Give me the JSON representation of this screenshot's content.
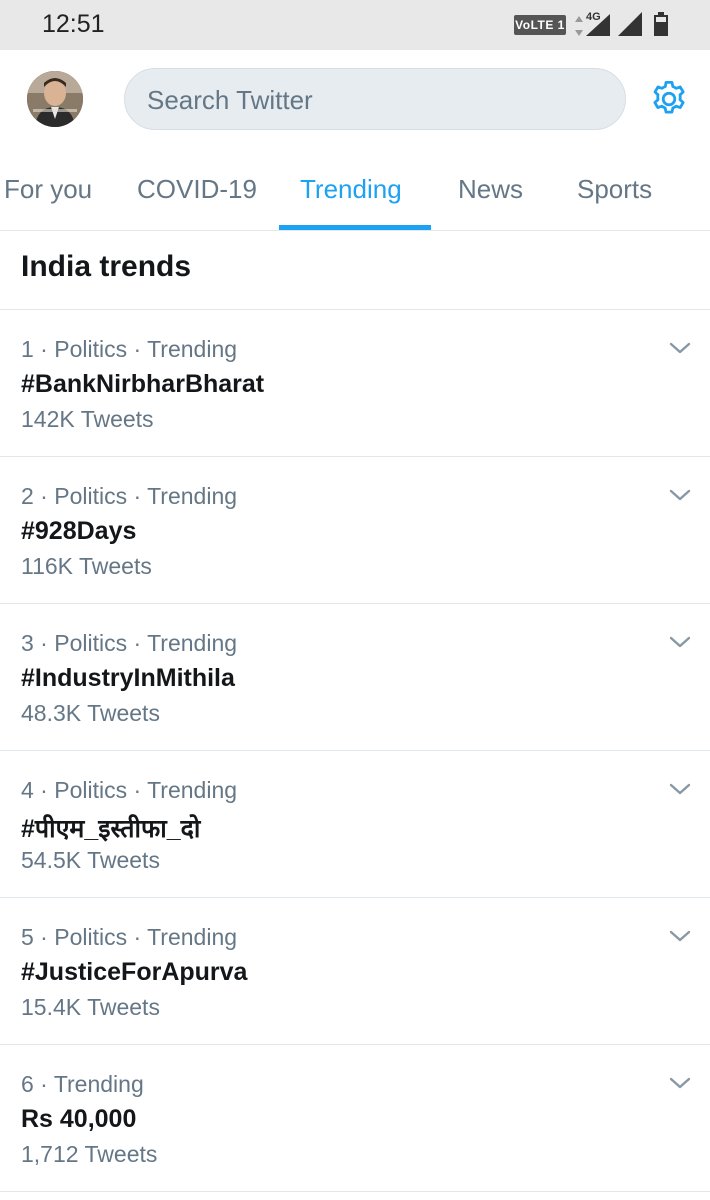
{
  "status_bar": {
    "time": "12:51",
    "volte": "VoLTE 1",
    "network": "4G"
  },
  "header": {
    "search_placeholder": "Search Twitter"
  },
  "tabs": [
    {
      "label": "For you"
    },
    {
      "label": "COVID-19"
    },
    {
      "label": "Trending",
      "active": true
    },
    {
      "label": "News"
    },
    {
      "label": "Sports"
    }
  ],
  "section": {
    "title": "India trends"
  },
  "trends": [
    {
      "meta": "1 · Politics · Trending",
      "name": "#BankNirbharBharat",
      "count": "142K Tweets"
    },
    {
      "meta": "2 · Politics · Trending",
      "name": "#928Days",
      "count": "116K Tweets"
    },
    {
      "meta": "3 · Politics · Trending",
      "name": "#IndustryInMithila",
      "count": "48.3K Tweets"
    },
    {
      "meta": "4 · Politics · Trending",
      "name": "#पीएम_इस्तीफा_दो",
      "count": "54.5K Tweets"
    },
    {
      "meta": "5 · Politics · Trending",
      "name": "#JusticeForApurva",
      "count": "15.4K Tweets"
    },
    {
      "meta": "6 · Trending",
      "name": "Rs 40,000",
      "count": "1,712 Tweets"
    }
  ],
  "colors": {
    "accent": "#1da1f2",
    "secondary_text": "#657786",
    "primary_text": "#14171a",
    "divider": "#e1e8ed"
  },
  "icons": {
    "settings": "gear-icon",
    "expand": "chevron-down-icon",
    "signal": "signal-icon",
    "battery": "battery-icon"
  }
}
